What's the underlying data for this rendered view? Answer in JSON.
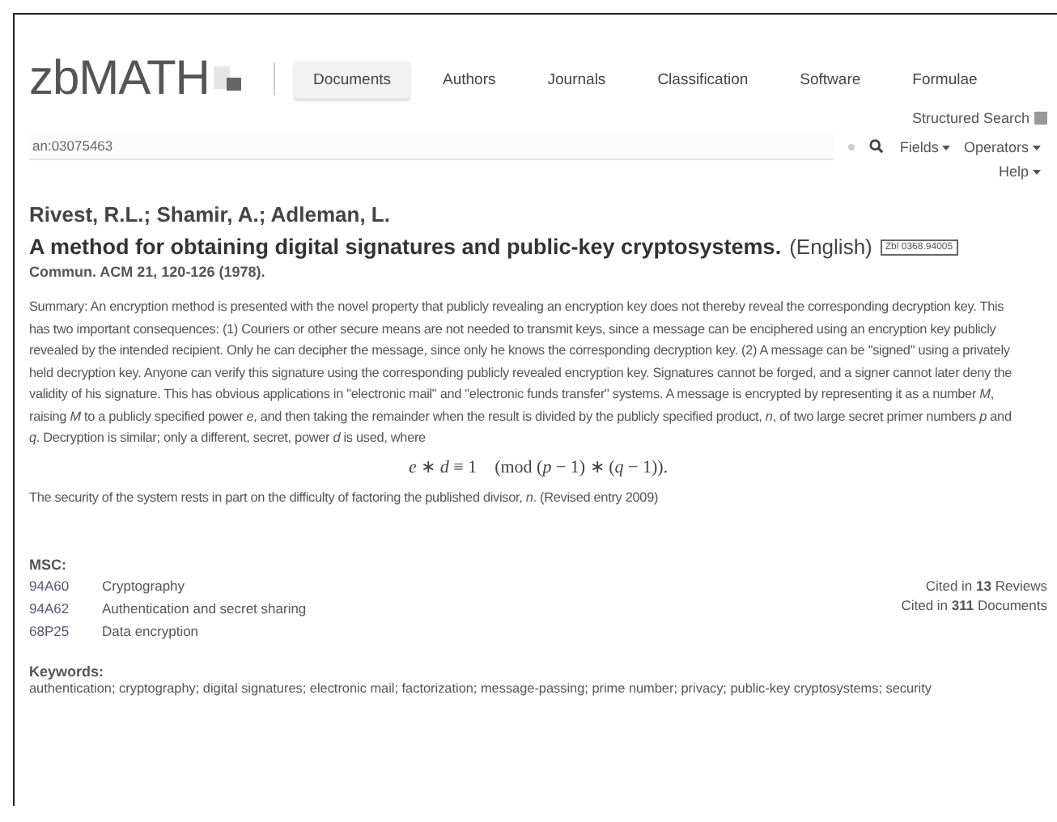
{
  "logo": "zbMATH",
  "tabs": [
    {
      "label": "Documents",
      "selected": true
    },
    {
      "label": "Authors",
      "selected": false
    },
    {
      "label": "Journals",
      "selected": false
    },
    {
      "label": "Classification",
      "selected": false
    },
    {
      "label": "Software",
      "selected": false
    },
    {
      "label": "Formulae",
      "selected": false
    }
  ],
  "structured_search": "Structured Search",
  "search": {
    "value": "an:03075463"
  },
  "search_tools": [
    "Fields",
    "Operators"
  ],
  "help": "Help",
  "authors": "Rivest, R.L.; Shamir, A.; Adleman, L.",
  "title": "A method for obtaining digital signatures and public-key cryptosystems.",
  "language": "(English)",
  "zbl_badge": "Zbl 0368.94005",
  "source": "Commun. ACM 21, 120-126 (1978).",
  "summary": "Summary: An encryption method is presented with the novel property that publicly revealing an encryption key does not thereby reveal the corresponding decryption key. This has two important consequences: (1) Couriers or other secure means are not needed to transmit keys, since a message can be enciphered using an encryption key publicly revealed by the intended recipient. Only he can decipher the message, since only he knows the corresponding decryption key. (2) A message can be \"signed\" using a privately held decryption key. Anyone can verify this signature using the corresponding publicly revealed encryption key. Signatures cannot be forged, and a signer cannot later deny the validity of his signature. This has obvious applications in \"electronic mail\" and \"electronic funds transfer\" systems. A message is encrypted by representing it as a number *M*, raising *M* to a publicly specified power *e*, and then taking the remainder when the result is divided by the publicly specified product, *n*, of two large secret primer numbers *p* and *q*. Decryption is similar; only a different, secret, power *d* is used, where",
  "formula": "*e* ∗ *d* ≡ 1    (mod (*p* − 1) ∗ (*q* − 1)).",
  "summary_end": "The security of the system rests in part on the difficulty of factoring the published divisor, *n*. (Revised entry 2009)",
  "msc": {
    "heading": "MSC:",
    "items": [
      {
        "code": "94A60",
        "label": "Cryptography"
      },
      {
        "code": "94A62",
        "label": "Authentication and secret sharing"
      },
      {
        "code": "68P25",
        "label": "Data encryption"
      }
    ]
  },
  "citations": [
    {
      "prefix": "Cited in",
      "count": "13",
      "suffix": "Reviews"
    },
    {
      "prefix": "Cited in",
      "count": "311",
      "suffix": "Documents"
    }
  ],
  "keywords": {
    "heading": "Keywords:",
    "text": "authentication; cryptography; digital signatures; electronic mail; factorization; message-passing; prime number; privacy; public-key cryptosystems; security"
  }
}
